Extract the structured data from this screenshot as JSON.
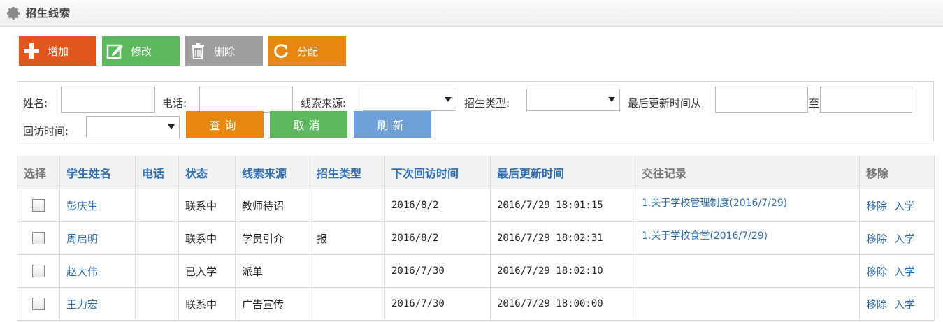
{
  "page": {
    "title": "招生线索"
  },
  "toolbar": {
    "add": "增加",
    "edit": "修改",
    "delete": "删除",
    "assign": "分配"
  },
  "search": {
    "name_label": "姓名:",
    "phone_label": "电话:",
    "source_label": "线索来源:",
    "type_label": "招生类型:",
    "updated_from_label": "最后更新时间从",
    "to_label": "至",
    "visit_label": "回访时间:",
    "query": "查询",
    "cancel": "取消",
    "refresh": "刷新"
  },
  "table": {
    "headers": [
      "选择",
      "学生姓名",
      "电话",
      "状态",
      "线索来源",
      "招生类型",
      "下次回访时间",
      "最后更新时间",
      "交往记录",
      "移除"
    ],
    "rows": [
      {
        "name": "彭庆生",
        "phone": "",
        "status": "联系中",
        "source": "教师待诏",
        "type": "",
        "next_visit": "2016/8/2",
        "updated": "2016/7/29 18:01:15",
        "record": "1.关于学校管理制度(2016/7/29)",
        "remove": "移除",
        "enroll": "入学"
      },
      {
        "name": "周启明",
        "phone": "",
        "status": "联系中",
        "source": "学员引介",
        "type": "报",
        "next_visit": "2016/8/2",
        "updated": "2016/7/29 18:02:31",
        "record": "1.关于学校食堂(2016/7/29)",
        "remove": "移除",
        "enroll": "入学"
      },
      {
        "name": "赵大伟",
        "phone": "",
        "status": "已入学",
        "source": "派单",
        "type": "",
        "next_visit": "2016/7/30",
        "updated": "2016/7/29 18:02:10",
        "record": "",
        "remove": "移除",
        "enroll": "入学"
      },
      {
        "name": "王力宏",
        "phone": "",
        "status": "联系中",
        "source": "广告宣传",
        "type": "",
        "next_visit": "2016/7/30",
        "updated": "2016/7/29 18:00:00",
        "record": "",
        "remove": "移除",
        "enroll": "入学"
      }
    ]
  },
  "colors": {
    "add": "#e0561c",
    "edit": "#5cb85c",
    "delete": "#9e9e9e",
    "assign": "#e8870f",
    "query": "#e8870f",
    "cancel": "#5cb85c",
    "refresh": "#6f9fd8",
    "link": "#2e6eb5"
  }
}
